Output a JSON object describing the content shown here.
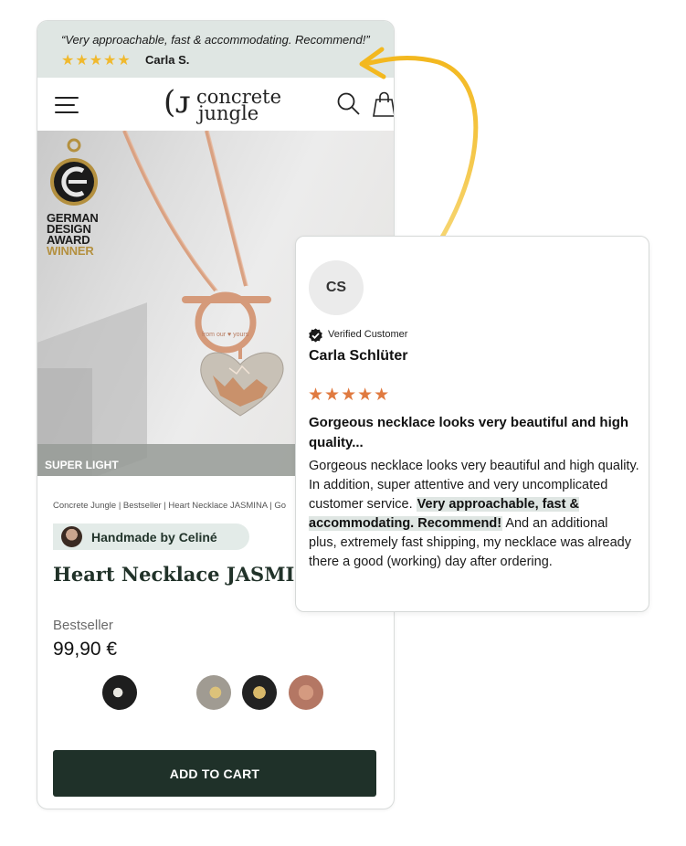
{
  "banner": {
    "quote": "“Very approachable, fast & accommodating. Recommend!”",
    "stars": "★★★★★",
    "author": "Carla S."
  },
  "header": {
    "logo_line1": "concrete",
    "logo_line2": "jungle",
    "menu_icon": "hamburger-menu-icon",
    "search_icon": "search-icon",
    "cart_icon": "shopping-bag-icon"
  },
  "hero": {
    "award_line1": "GERMAN",
    "award_line2": "DESIGN",
    "award_line3": "AWARD",
    "award_line4": "WINNER",
    "badge": "SUPER LIGHT"
  },
  "product": {
    "breadcrumb": "Concrete Jungle | Bestseller | Heart Necklace JASMINA | Go",
    "handmade": "Handmade by Celiné",
    "title": "Heart Necklace JASMINA | Rose",
    "subtitle": "Bestseller",
    "price": "99,90 €",
    "add_to_cart": "ADD TO CART"
  },
  "review": {
    "initials": "CS",
    "verified": "Verified Customer",
    "name": "Carla Schlüter",
    "stars": "★★★★★",
    "title": "Gorgeous necklace looks very beautiful and high quality...",
    "body_part1": "Gorgeous necklace looks very beautiful and high quality. In addition, super attentive and very uncomplicated customer service. ",
    "body_highlight": "Very approachable, fast & accommodating. Recommend!",
    "body_part2": " And an additional plus, extremely fast shipping, my necklace was already there a good (working) day after ordering."
  },
  "colors": {
    "accent_green": "#1f3129",
    "banner_bg": "#dfe6e3",
    "banner_star": "#f0b92e",
    "review_star": "#e07a40",
    "arrow": "#f3b81f"
  }
}
